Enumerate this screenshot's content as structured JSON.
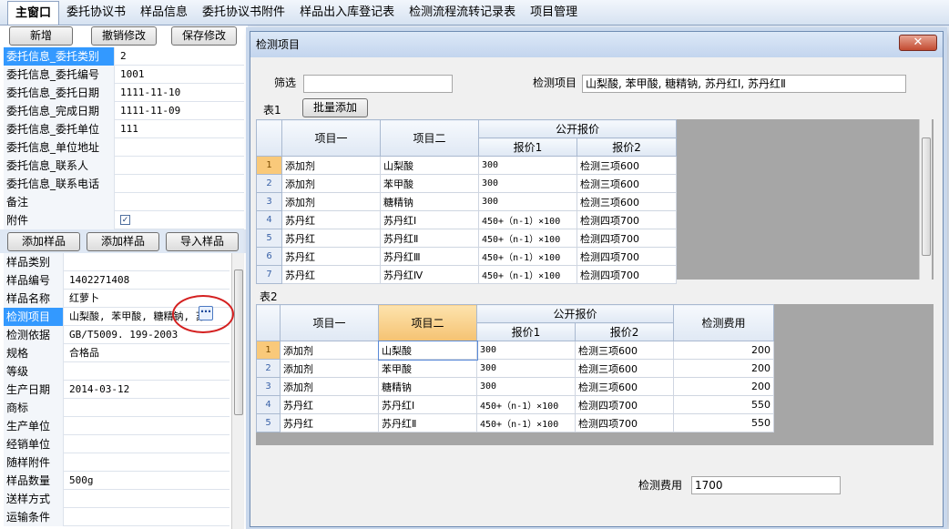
{
  "tabs": [
    "主窗口",
    "委托协议书",
    "样品信息",
    "委托协议书附件",
    "样品出入库登记表",
    "检测流程流转记录表",
    "项目管理"
  ],
  "toolbar": {
    "add": "新增",
    "undo": "撤销修改",
    "save": "保存修改"
  },
  "entrust_props": [
    {
      "label": "委托信息_委托类别",
      "value": "2"
    },
    {
      "label": "委托信息_委托编号",
      "value": "1001"
    },
    {
      "label": "委托信息_委托日期",
      "value": "1111-11-10"
    },
    {
      "label": "委托信息_完成日期",
      "value": "1111-11-09"
    },
    {
      "label": "委托信息_委托单位",
      "value": "111"
    },
    {
      "label": "委托信息_单位地址",
      "value": ""
    },
    {
      "label": "委托信息_联系人",
      "value": ""
    },
    {
      "label": "委托信息_联系电话",
      "value": ""
    },
    {
      "label": "备注",
      "value": ""
    },
    {
      "label": "附件",
      "value": ""
    }
  ],
  "sample_buttons": {
    "add1": "添加样品",
    "add2": "添加样品",
    "import": "导入样品"
  },
  "sample_props": [
    {
      "label": "样品类别",
      "value": ""
    },
    {
      "label": "样品编号",
      "value": "1402271408"
    },
    {
      "label": "样品名称",
      "value": "红萝卜"
    },
    {
      "label": "检测项目",
      "value": "山梨酸, 苯甲酸, 糖精钠, 苏"
    },
    {
      "label": "检测依据",
      "value": "GB/T5009. 199-2003"
    },
    {
      "label": "规格",
      "value": "合格品"
    },
    {
      "label": "等级",
      "value": ""
    },
    {
      "label": "生产日期",
      "value": "2014-03-12"
    },
    {
      "label": "商标",
      "value": ""
    },
    {
      "label": "生产单位",
      "value": ""
    },
    {
      "label": "经销单位",
      "value": ""
    },
    {
      "label": "随样附件",
      "value": ""
    },
    {
      "label": "样品数量",
      "value": "500g"
    },
    {
      "label": "送样方式",
      "value": ""
    },
    {
      "label": "运输条件",
      "value": ""
    }
  ],
  "dialog": {
    "title": "检测项目",
    "close": "✕",
    "filter_label": "筛选",
    "filter_value": "",
    "items_label": "检测项目",
    "items_value": "山梨酸, 苯甲酸, 糖精钠, 苏丹红Ⅰ, 苏丹红Ⅱ",
    "table1_label": "表1",
    "batch_add": "批量添加",
    "table2_label": "表2",
    "fee_label": "检测费用",
    "fee_value": "1700"
  },
  "table1": {
    "headers": {
      "c1": "项目一",
      "c2": "项目二",
      "group": "公开报价",
      "p1": "报价1",
      "p2": "报价2"
    },
    "rows": [
      {
        "n": "1",
        "c1": "添加剂",
        "c2": "山梨酸",
        "p1": "300",
        "p2": "检测三项600"
      },
      {
        "n": "2",
        "c1": "添加剂",
        "c2": "苯甲酸",
        "p1": "300",
        "p2": "检测三项600"
      },
      {
        "n": "3",
        "c1": "添加剂",
        "c2": "糖精钠",
        "p1": "300",
        "p2": "检测三项600"
      },
      {
        "n": "4",
        "c1": "苏丹红",
        "c2": "苏丹红Ⅰ",
        "p1": "450+（n-1）×100",
        "p2": "检测四项700"
      },
      {
        "n": "5",
        "c1": "苏丹红",
        "c2": "苏丹红Ⅱ",
        "p1": "450+（n-1）×100",
        "p2": "检测四项700"
      },
      {
        "n": "6",
        "c1": "苏丹红",
        "c2": "苏丹红Ⅲ",
        "p1": "450+（n-1）×100",
        "p2": "检测四项700"
      },
      {
        "n": "7",
        "c1": "苏丹红",
        "c2": "苏丹红Ⅳ",
        "p1": "450+（n-1）×100",
        "p2": "检测四项700"
      }
    ]
  },
  "table2": {
    "headers": {
      "c1": "项目一",
      "c2": "项目二",
      "group": "公开报价",
      "p1": "报价1",
      "p2": "报价2",
      "fee": "检测费用"
    },
    "rows": [
      {
        "n": "1",
        "c1": "添加剂",
        "c2": "山梨酸",
        "p1": "300",
        "p2": "检测三项600",
        "fee": "200"
      },
      {
        "n": "2",
        "c1": "添加剂",
        "c2": "苯甲酸",
        "p1": "300",
        "p2": "检测三项600",
        "fee": "200"
      },
      {
        "n": "3",
        "c1": "添加剂",
        "c2": "糖精钠",
        "p1": "300",
        "p2": "检测三项600",
        "fee": "200"
      },
      {
        "n": "4",
        "c1": "苏丹红",
        "c2": "苏丹红Ⅰ",
        "p1": "450+（n-1）×100",
        "p2": "检测四项700",
        "fee": "550"
      },
      {
        "n": "5",
        "c1": "苏丹红",
        "c2": "苏丹红Ⅱ",
        "p1": "450+（n-1）×100",
        "p2": "检测四项700",
        "fee": "550"
      }
    ]
  },
  "icons": {
    "ellipsis": "ellipsis-icon",
    "check": "checkmark-icon",
    "annotation": "red-circle-annotation"
  },
  "colors": {
    "selection": "#3399ff",
    "current_row": "#f9c97a",
    "annotation": "#d42020"
  }
}
